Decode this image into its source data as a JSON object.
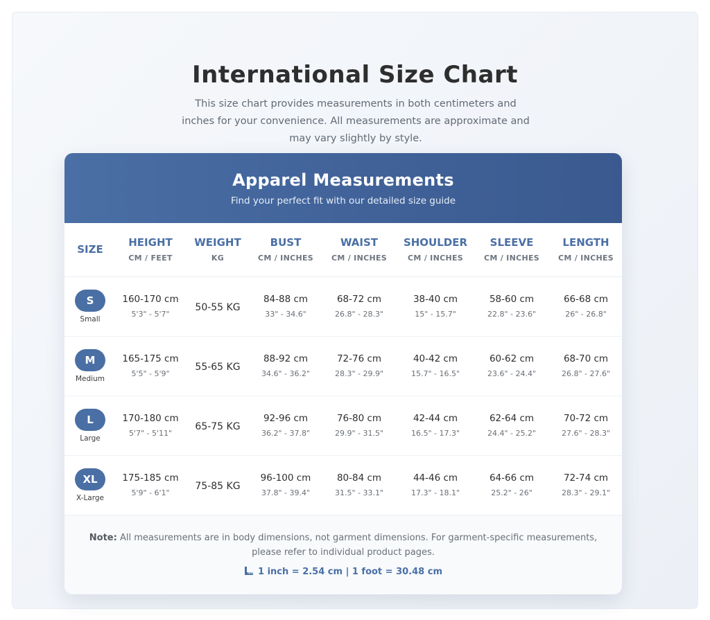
{
  "page": {
    "title": "International Size Chart",
    "intro": "This size chart provides measurements in both centimeters and inches for your convenience. All measurements are approximate and may vary slightly by style."
  },
  "card": {
    "title": "Apparel Measurements",
    "subtitle": "Find your perfect fit with our detailed size guide"
  },
  "columns": [
    {
      "name": "SIZE",
      "unit": ""
    },
    {
      "name": "HEIGHT",
      "unit": "CM / FEET"
    },
    {
      "name": "WEIGHT",
      "unit": "KG"
    },
    {
      "name": "BUST",
      "unit": "CM / INCHES"
    },
    {
      "name": "WAIST",
      "unit": "CM / INCHES"
    },
    {
      "name": "SHOULDER",
      "unit": "CM / INCHES"
    },
    {
      "name": "SLEEVE",
      "unit": "CM / INCHES"
    },
    {
      "name": "LENGTH",
      "unit": "CM / INCHES"
    }
  ],
  "rows": [
    {
      "size": "S",
      "size_name": "Small",
      "height": {
        "cm": "160-170 cm",
        "imp": "5'3\" - 5'7\""
      },
      "weight": "50-55 KG",
      "bust": {
        "cm": "84-88 cm",
        "imp": "33\" - 34.6\""
      },
      "waist": {
        "cm": "68-72 cm",
        "imp": "26.8\" - 28.3\""
      },
      "shoulder": {
        "cm": "38-40 cm",
        "imp": "15\" - 15.7\""
      },
      "sleeve": {
        "cm": "58-60 cm",
        "imp": "22.8\" - 23.6\""
      },
      "length": {
        "cm": "66-68 cm",
        "imp": "26\" - 26.8\""
      }
    },
    {
      "size": "M",
      "size_name": "Medium",
      "height": {
        "cm": "165-175 cm",
        "imp": "5'5\" - 5'9\""
      },
      "weight": "55-65 KG",
      "bust": {
        "cm": "88-92 cm",
        "imp": "34.6\" - 36.2\""
      },
      "waist": {
        "cm": "72-76 cm",
        "imp": "28.3\" - 29.9\""
      },
      "shoulder": {
        "cm": "40-42 cm",
        "imp": "15.7\" - 16.5\""
      },
      "sleeve": {
        "cm": "60-62 cm",
        "imp": "23.6\" - 24.4\""
      },
      "length": {
        "cm": "68-70 cm",
        "imp": "26.8\" - 27.6\""
      }
    },
    {
      "size": "L",
      "size_name": "Large",
      "height": {
        "cm": "170-180 cm",
        "imp": "5'7\" - 5'11\""
      },
      "weight": "65-75 KG",
      "bust": {
        "cm": "92-96 cm",
        "imp": "36.2\" - 37.8\""
      },
      "waist": {
        "cm": "76-80 cm",
        "imp": "29.9\" - 31.5\""
      },
      "shoulder": {
        "cm": "42-44 cm",
        "imp": "16.5\" - 17.3\""
      },
      "sleeve": {
        "cm": "62-64 cm",
        "imp": "24.4\" - 25.2\""
      },
      "length": {
        "cm": "70-72 cm",
        "imp": "27.6\" - 28.3\""
      }
    },
    {
      "size": "XL",
      "size_name": "X-Large",
      "height": {
        "cm": "175-185 cm",
        "imp": "5'9\" - 6'1\""
      },
      "weight": "75-85 KG",
      "bust": {
        "cm": "96-100 cm",
        "imp": "37.8\" - 39.4\""
      },
      "waist": {
        "cm": "80-84 cm",
        "imp": "31.5\" - 33.1\""
      },
      "shoulder": {
        "cm": "44-46 cm",
        "imp": "17.3\" - 18.1\""
      },
      "sleeve": {
        "cm": "64-66 cm",
        "imp": "25.2\" - 26\""
      },
      "length": {
        "cm": "72-74 cm",
        "imp": "28.3\" - 29.1\""
      }
    }
  ],
  "footer": {
    "note_label": "Note:",
    "note_text": " All measurements are in body dimensions, not garment dimensions. For garment-specific measurements, please refer to individual product pages.",
    "conversion_icon": "ruler-icon",
    "conversion": "1 inch = 2.54 cm | 1 foot = 30.48 cm"
  },
  "colors": {
    "accent": "#4a6fa5",
    "header_start": "#4a6fa5",
    "header_end": "#3a5a8f"
  }
}
